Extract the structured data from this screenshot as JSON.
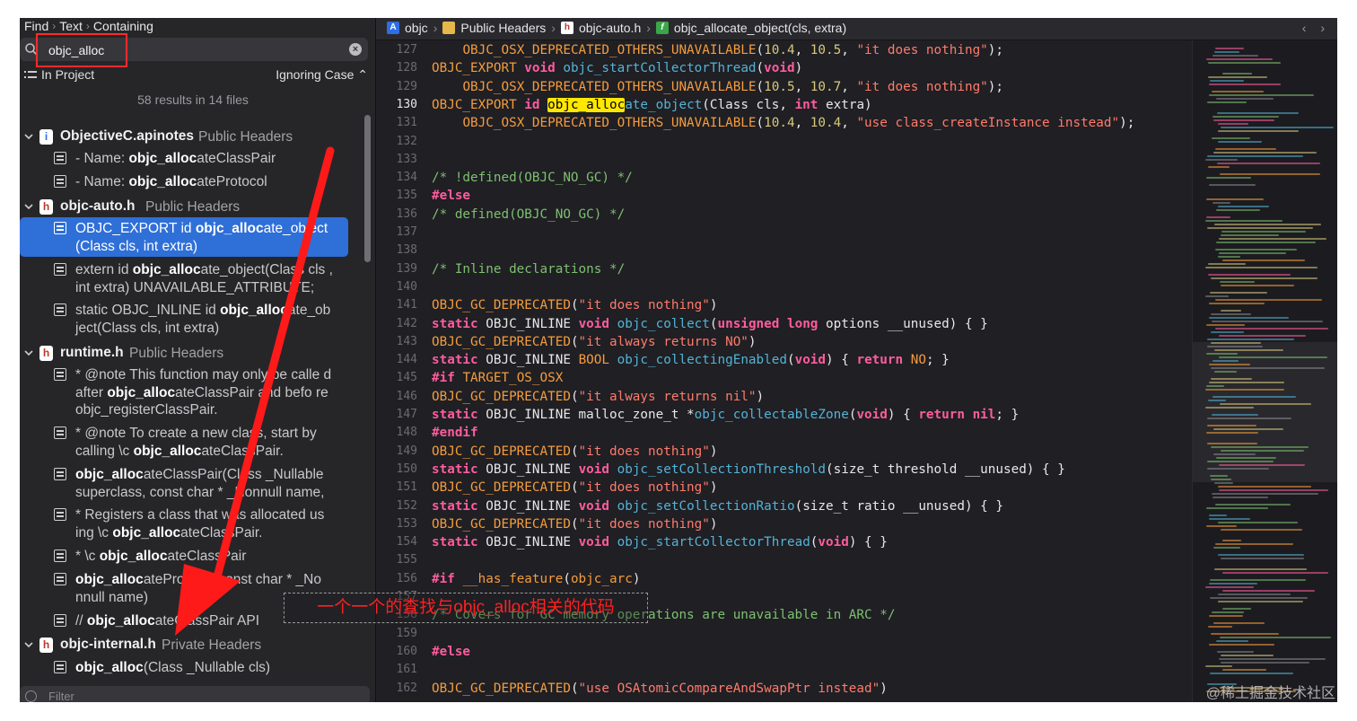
{
  "find_bar": {
    "find": "Find",
    "text": "Text",
    "containing": "Containing"
  },
  "search": {
    "value": "objc_alloc"
  },
  "scope": {
    "label": "In Project",
    "case": "Ignoring Case ⌃"
  },
  "result_count": "58 results in 14 files",
  "groups": [
    {
      "name": "ObjectiveC.apinotes",
      "sub": "Public Headers",
      "icon": "i"
    },
    {
      "name": "objc-auto.h",
      "sub": "Public Headers",
      "icon": "h"
    },
    {
      "name": "runtime.h",
      "sub": "Public Headers",
      "icon": "h"
    },
    {
      "name": "objc-internal.h",
      "sub": "Private Headers",
      "icon": "h"
    }
  ],
  "results": [
    {
      "pre": "- Name: ",
      "match": "objc_alloc",
      "post": "ateClassPair"
    },
    {
      "pre": "- Name: ",
      "match": "objc_alloc",
      "post": "ateProtocol"
    },
    {
      "pre": "OBJC_EXPORT id ",
      "match": "objc_alloc",
      "post": "ate_object (Class cls, int extra)"
    },
    {
      "pre": "extern id ",
      "match": "objc_alloc",
      "post": "ate_object(Class cls , int extra) UNAVAILABLE_ATTRIBUTE;"
    },
    {
      "pre": "static OBJC_INLINE id ",
      "match": "objc_alloc",
      "post": "ate_ob ject(Class cls, int extra)"
    },
    {
      "pre": "* @note This function may only be calle d after ",
      "match": "objc_alloc",
      "post": "ateClassPair and befo re objc_registerClassPair."
    },
    {
      "pre": "* @note To create a new class, start by calling \\c ",
      "match": "objc_alloc",
      "post": "ateClassPair."
    },
    {
      "pre": "",
      "match": "objc_alloc",
      "post": "ateClassPair(Class _Nullable superclass, const char * _Nonnull name,"
    },
    {
      "pre": "* Registers a class that was allocated us ing \\c ",
      "match": "objc_alloc",
      "post": "ateClassPair."
    },
    {
      "pre": "*  \\c ",
      "match": "objc_alloc",
      "post": "ateClassPair"
    },
    {
      "pre": "",
      "match": "objc_alloc",
      "post": "ateProtocol(const char * _No nnull name)"
    },
    {
      "pre": "// ",
      "match": "objc_alloc",
      "post": "ateClassPair API"
    },
    {
      "pre": "",
      "match": "objc_alloc",
      "post": "(Class _Nullable cls)"
    }
  ],
  "filter_placeholder": "Filter",
  "jumpbar": {
    "items": [
      "objc",
      "Public Headers",
      "objc-auto.h",
      "objc_allocate_object(cls, extra)"
    ],
    "arrows": "‹ ›"
  },
  "code_lines": [
    {
      "n": "127",
      "h": "    <span class='mac'>OBJC_OSX_DEPRECATED_OTHERS_UNAVAILABLE</span>(<span class='num'>10.4</span>, <span class='num'>10.5</span>, <span class='str'>\"it does nothing\"</span>);"
    },
    {
      "n": "128",
      "h": "<span class='mac'>OBJC_EXPORT</span> <span class='kw'>void</span> <span class='fn'>objc_startCollectorThread</span>(<span class='kw'>void</span>)"
    },
    {
      "n": "129",
      "h": "    <span class='mac'>OBJC_OSX_DEPRECATED_OTHERS_UNAVAILABLE</span>(<span class='num'>10.5</span>, <span class='num'>10.7</span>, <span class='str'>\"it does nothing\"</span>);"
    },
    {
      "n": "130",
      "h": "<span class='mac'>OBJC_EXPORT</span> <span class='kw'>id</span> <span class='hl'>objc_alloc</span><span class='fn'>ate_object</span>(Class cls, <span class='kw'>int</span> extra)",
      "cur": true
    },
    {
      "n": "131",
      "h": "    <span class='mac'>OBJC_OSX_DEPRECATED_OTHERS_UNAVAILABLE</span>(<span class='num'>10.4</span>, <span class='num'>10.4</span>, <span class='str'>\"use class_createInstance instead\"</span>);"
    },
    {
      "n": "132",
      "h": ""
    },
    {
      "n": "133",
      "h": ""
    },
    {
      "n": "134",
      "h": "<span class='cm'>/* !defined(OBJC_NO_GC) */</span>"
    },
    {
      "n": "135",
      "h": "<span class='kw'>#else</span>"
    },
    {
      "n": "136",
      "h": "<span class='cm'>/* defined(OBJC_NO_GC) */</span>"
    },
    {
      "n": "137",
      "h": ""
    },
    {
      "n": "138",
      "h": ""
    },
    {
      "n": "139",
      "h": "<span class='cm'>/* Inline declarations */</span>"
    },
    {
      "n": "140",
      "h": ""
    },
    {
      "n": "141",
      "h": "<span class='mac'>OBJC_GC_DEPRECATED</span>(<span class='str'>\"it does nothing\"</span>)"
    },
    {
      "n": "142",
      "h": "<span class='kw'>static</span> OBJC_INLINE <span class='kw'>void</span> <span class='fn'>objc_collect</span>(<span class='kw'>unsigned long</span> options __unused) { }"
    },
    {
      "n": "143",
      "h": "<span class='mac'>OBJC_GC_DEPRECATED</span>(<span class='str'>\"it always returns NO\"</span>)"
    },
    {
      "n": "144",
      "h": "<span class='kw'>static</span> OBJC_INLINE <span class='mac'>BOOL</span> <span class='fn'>objc_collectingEnabled</span>(<span class='kw'>void</span>) { <span class='kw'>return</span> <span class='mac'>NO</span>; }"
    },
    {
      "n": "145",
      "h": "<span class='kw'>#if</span> <span class='mac'>TARGET_OS_OSX</span>"
    },
    {
      "n": "146",
      "h": "<span class='mac'>OBJC_GC_DEPRECATED</span>(<span class='str'>\"it always returns nil\"</span>)"
    },
    {
      "n": "147",
      "h": "<span class='kw'>static</span> OBJC_INLINE malloc_zone_t *<span class='fn'>objc_collectableZone</span>(<span class='kw'>void</span>) { <span class='kw'>return</span> <span class='kw'>nil</span>; }"
    },
    {
      "n": "148",
      "h": "<span class='kw'>#endif</span>"
    },
    {
      "n": "149",
      "h": "<span class='mac'>OBJC_GC_DEPRECATED</span>(<span class='str'>\"it does nothing\"</span>)"
    },
    {
      "n": "150",
      "h": "<span class='kw'>static</span> OBJC_INLINE <span class='kw'>void</span> <span class='fn'>objc_setCollectionThreshold</span>(size_t threshold __unused) { }"
    },
    {
      "n": "151",
      "h": "<span class='mac'>OBJC_GC_DEPRECATED</span>(<span class='str'>\"it does nothing\"</span>)"
    },
    {
      "n": "152",
      "h": "<span class='kw'>static</span> OBJC_INLINE <span class='kw'>void</span> <span class='fn'>objc_setCollectionRatio</span>(size_t ratio __unused) { }"
    },
    {
      "n": "153",
      "h": "<span class='mac'>OBJC_GC_DEPRECATED</span>(<span class='str'>\"it does nothing\"</span>)"
    },
    {
      "n": "154",
      "h": "<span class='kw'>static</span> OBJC_INLINE <span class='kw'>void</span> <span class='fn'>objc_startCollectorThread</span>(<span class='kw'>void</span>) { }"
    },
    {
      "n": "155",
      "h": ""
    },
    {
      "n": "156",
      "h": "<span class='kw'>#if</span> <span class='mac'>__has_feature</span>(<span class='mac'>objc_arc</span>)"
    },
    {
      "n": "157",
      "h": ""
    },
    {
      "n": "158",
      "h": "<span class='cm'>/* Covers for GC memory operations are unavailable in ARC */</span>"
    },
    {
      "n": "159",
      "h": ""
    },
    {
      "n": "160",
      "h": "<span class='kw'>#else</span>"
    },
    {
      "n": "161",
      "h": ""
    },
    {
      "n": "162",
      "h": "<span class='mac'>OBJC_GC_DEPRECATED</span>(<span class='str'>\"use OSAtomicCompareAndSwapPtr instead\"</span>)"
    }
  ],
  "annotation": "一个一个的查找与objc_alloc相关的代码",
  "watermark": "@稀土掘金技术社区",
  "colors": {
    "selection": "#2f6fd8",
    "annotation": "#ff2020",
    "highlight": "#ffe800"
  }
}
